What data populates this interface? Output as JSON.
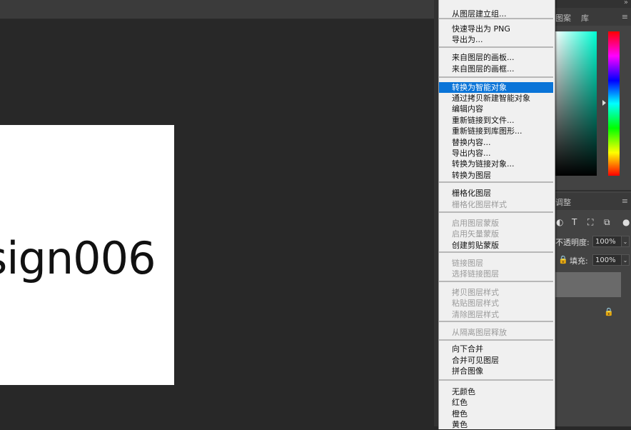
{
  "canvas": {
    "artboard_text": "sign006"
  },
  "right_panel": {
    "tabs": [
      "图案",
      "库"
    ],
    "adjust_label": "调整",
    "opacity_label": "不透明度:",
    "opacity_value": "100%",
    "fill_label": "填充:",
    "fill_value": "100%"
  },
  "menu": {
    "items": [
      {
        "label": "从图层建立组...",
        "disabled": false
      },
      {
        "label": "快速导出为 PNG",
        "disabled": false
      },
      {
        "label": "导出为...",
        "disabled": false
      },
      {
        "label": "来自图层的画板...",
        "disabled": false
      },
      {
        "label": "来自图层的画框...",
        "disabled": false
      },
      {
        "label": "转换为智能对象",
        "disabled": false,
        "highlighted": true
      },
      {
        "label": "通过拷贝新建智能对象",
        "disabled": false
      },
      {
        "label": "编辑内容",
        "disabled": false
      },
      {
        "label": "重新链接到文件...",
        "disabled": false
      },
      {
        "label": "重新链接到库图形...",
        "disabled": false
      },
      {
        "label": "替换内容...",
        "disabled": false
      },
      {
        "label": "导出内容...",
        "disabled": false
      },
      {
        "label": "转换为链接对象...",
        "disabled": false
      },
      {
        "label": "转换为图层",
        "disabled": false
      },
      {
        "label": "栅格化图层",
        "disabled": false
      },
      {
        "label": "栅格化图层样式",
        "disabled": true
      },
      {
        "label": "启用图层蒙版",
        "disabled": true
      },
      {
        "label": "启用矢量蒙版",
        "disabled": true
      },
      {
        "label": "创建剪贴蒙版",
        "disabled": false
      },
      {
        "label": "链接图层",
        "disabled": true
      },
      {
        "label": "选择链接图层",
        "disabled": true
      },
      {
        "label": "拷贝图层样式",
        "disabled": true
      },
      {
        "label": "粘贴图层样式",
        "disabled": true
      },
      {
        "label": "清除图层样式",
        "disabled": true
      },
      {
        "label": "从隔离图层释放",
        "disabled": true
      },
      {
        "label": "向下合并",
        "disabled": false
      },
      {
        "label": "合并可见图层",
        "disabled": false
      },
      {
        "label": "拼合图像",
        "disabled": false
      },
      {
        "label": "无颜色",
        "disabled": false
      },
      {
        "label": "红色",
        "disabled": false
      },
      {
        "label": "橙色",
        "disabled": false
      },
      {
        "label": "黄色",
        "disabled": false
      }
    ]
  },
  "colors": {
    "highlight": "#0a74d8",
    "menu_bg": "#f0f0f0",
    "disabled_text": "#9a9a9a"
  }
}
